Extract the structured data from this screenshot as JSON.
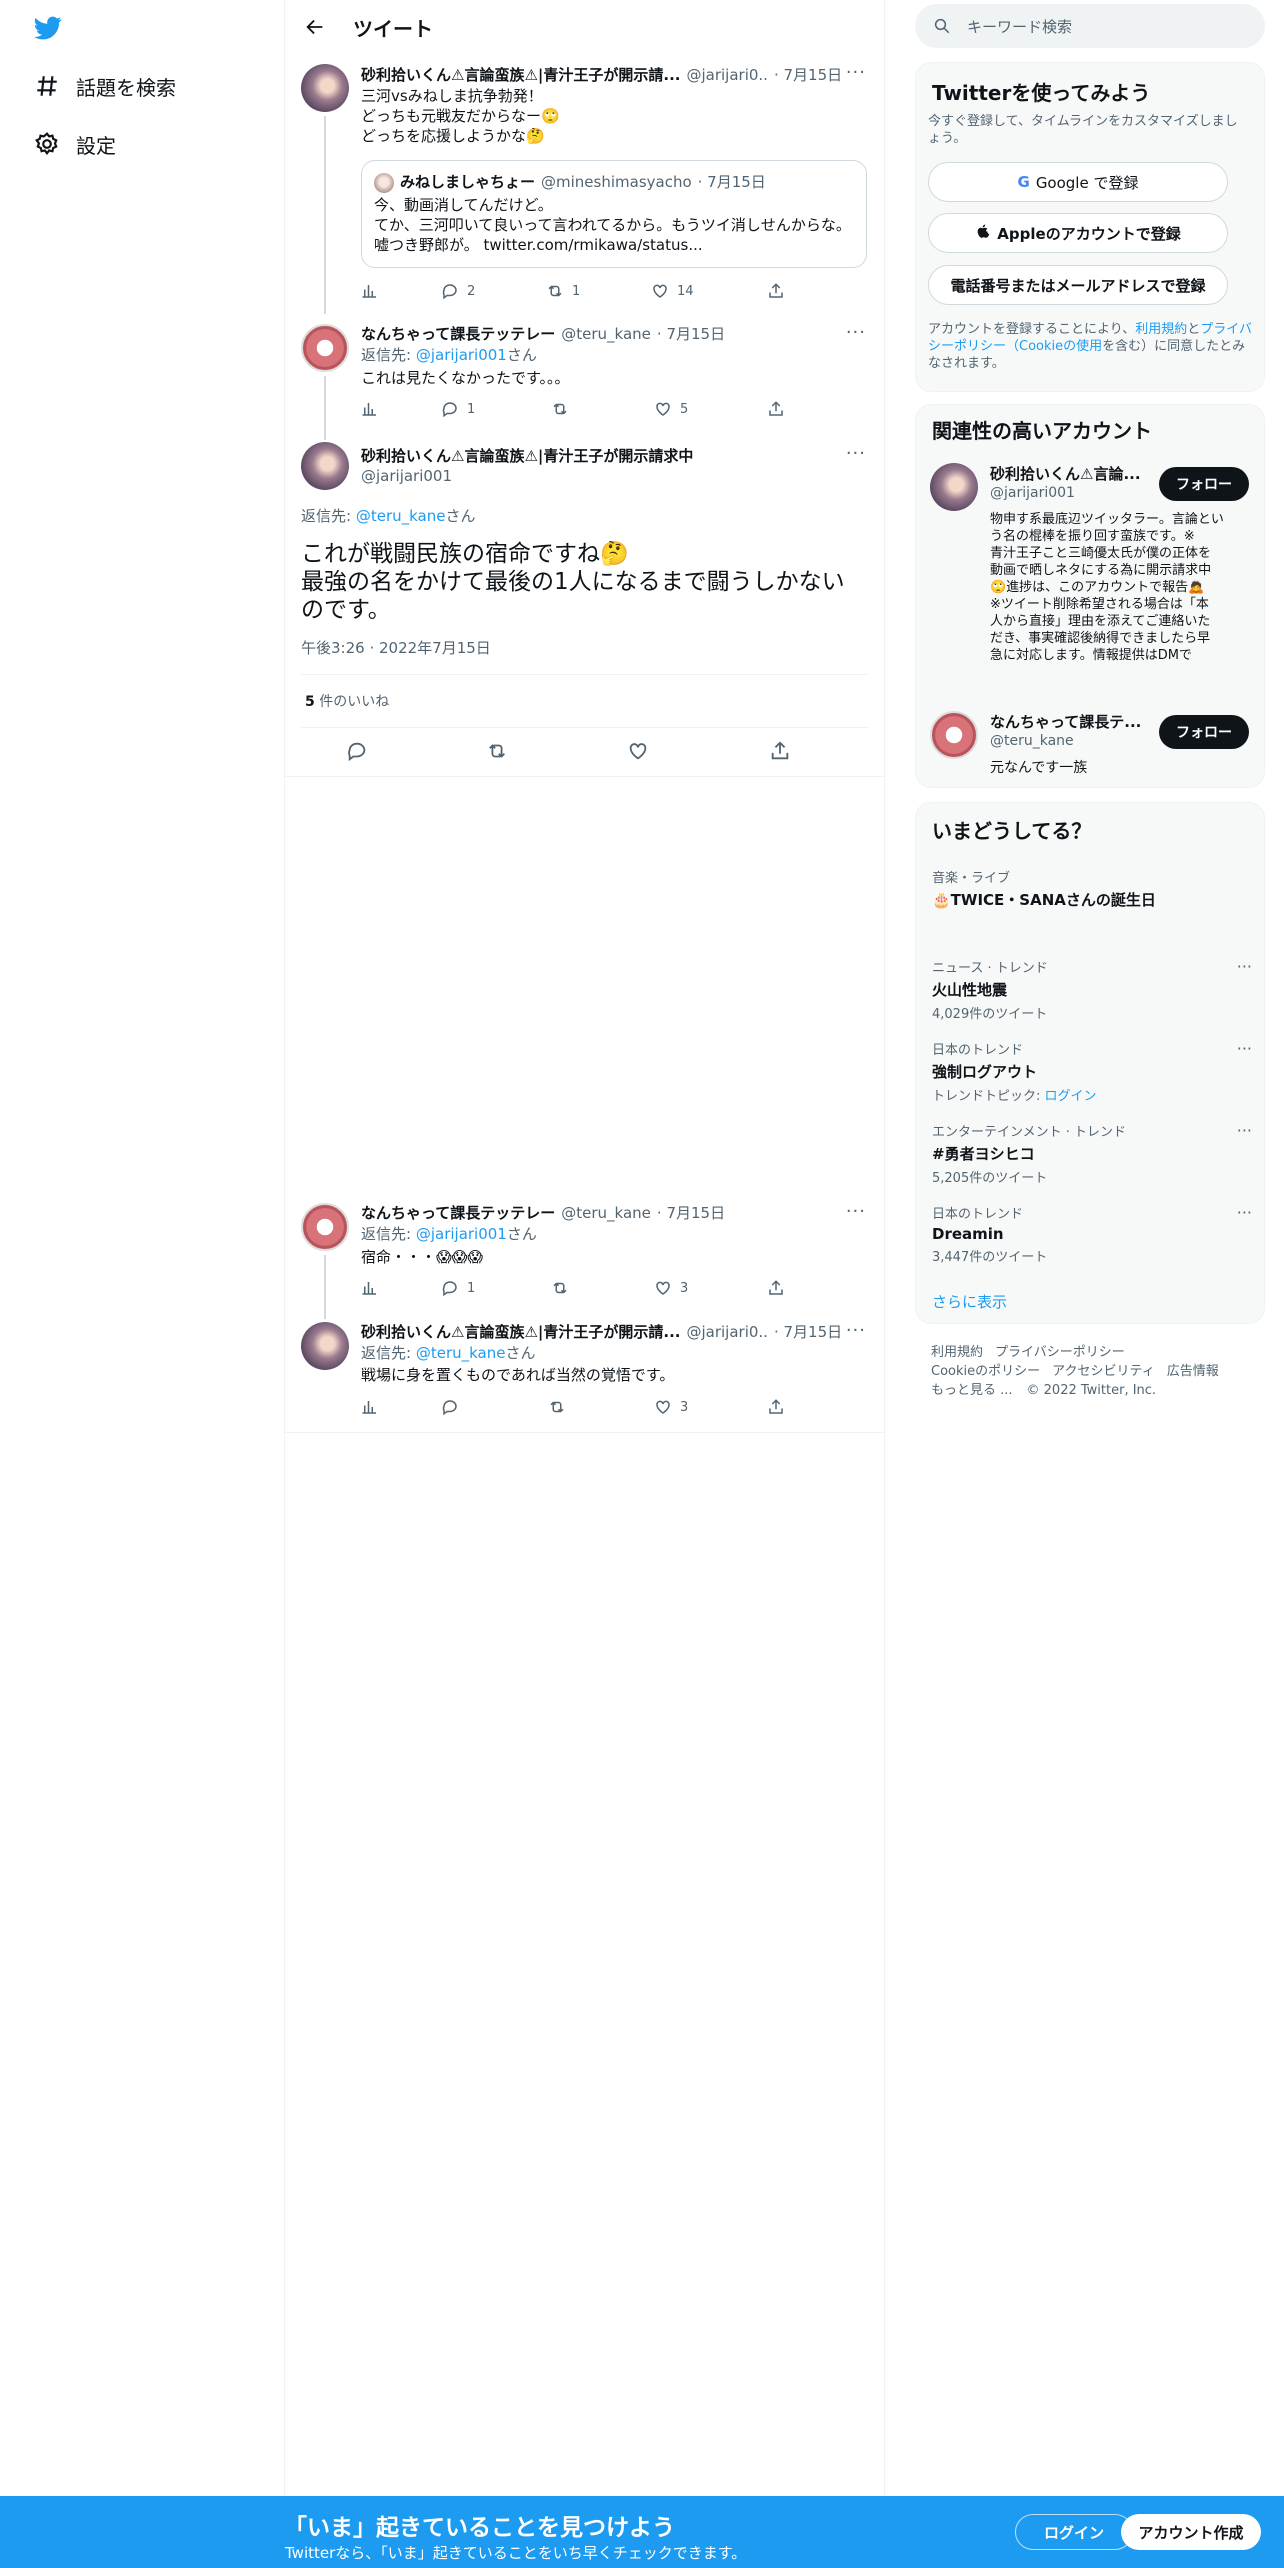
{
  "nav": {
    "explore_label": "話題を検索",
    "settings_label": "設定"
  },
  "header": {
    "title": "ツイート"
  },
  "tweet1": {
    "name": "砂利拾いくん⚠言論蛮族⚠|青汁王子が開示請...",
    "handle": "@jarijari0..",
    "date": "· 7月15日",
    "lines": [
      "三河vsみねしま抗争勃発！",
      "どっちも元戦友だからなー🙄",
      "どっちを応援しようかな🤔"
    ],
    "quote": {
      "name": "みねしましゃちょー",
      "handle": "@mineshimasyacho",
      "date": "· 7月15日",
      "lines": [
        "今、動画消してんだけど。",
        "てか、三河叩いて良いって言われてるから。もうツイ消しせんからな。",
        "嘘つき野郎が。 twitter.com/rmikawa/status..."
      ]
    },
    "replies": "2",
    "retweets": "1",
    "likes": "14"
  },
  "tweet2": {
    "name": "なんちゃって課長テッテレー",
    "handle": "@teru_kane",
    "date": "· 7月15日",
    "reply_prefix": "返信先: ",
    "reply_to": "@jarijari001",
    "reply_suffix": "さん",
    "text": "これは見たくなかったです。。。",
    "replies": "1",
    "retweets": "",
    "likes": "5"
  },
  "main_tweet": {
    "name": "砂利拾いくん⚠言論蛮族⚠|青汁王子が開示請求中",
    "handle": "@jarijari001",
    "reply_prefix": "返信先: ",
    "reply_to": "@teru_kane",
    "reply_suffix": "さん",
    "line1": "これが戦闘民族の宿命ですね🤔",
    "line2": "最強の名をかけて最後の1人になるまで闘うしかない",
    "line3": "のです。",
    "timestamp": "午後3:26 · 2022年7月15日",
    "likes_count": "5",
    "likes_label": " 件のいいね"
  },
  "tweet3": {
    "name": "なんちゃって課長テッテレー",
    "handle": "@teru_kane",
    "date": "· 7月15日",
    "reply_prefix": "返信先: ",
    "reply_to": "@jarijari001",
    "reply_suffix": "さん",
    "text": "宿命・・・😱😱😱",
    "replies": "1",
    "retweets": "",
    "likes": "3"
  },
  "tweet4": {
    "name": "砂利拾いくん⚠言論蛮族⚠|青汁王子が開示請...",
    "handle": "@jarijari0..",
    "date": "· 7月15日",
    "reply_prefix": "返信先: ",
    "reply_to": "@teru_kane",
    "reply_suffix": "さん",
    "text": "戦場に身を置くものであれば当然の覚悟です。",
    "replies": "",
    "retweets": "",
    "likes": "3"
  },
  "search": {
    "placeholder": "キーワード検索"
  },
  "signup_card": {
    "title": "Twitterを使ってみよう",
    "subtitle": "今すぐ登録して、タイムラインをカスタマイズしましょう。",
    "google": "Google で登録",
    "apple": "Appleのアカウントで登録",
    "phone": "電話番号またはメールアドレスで登録",
    "legal_1": "アカウントを登録することにより、",
    "legal_terms": "利用規約",
    "legal_2": "と",
    "legal_privacy": "プライバシーポリシー（Cookieの使用",
    "legal_3": "を含む）に同意したとみなされます。"
  },
  "related": {
    "title": "関連性の高いアカウント",
    "follow": "フォロー",
    "acc1": {
      "name": "砂利拾いくん⚠言論...",
      "handle": "@jarijari001",
      "bio": [
        "物申す系最底辺ツイッタラー。言論とい",
        "う名の棍棒を振り回す蛮族です。※",
        "青汁王子こと三崎優太氏が僕の正体を",
        "動画で晒しネタにする為に開示請求中",
        "🙄進捗は、このアカウントで報告🙇",
        "※ツイート削除希望される場合は「本",
        "人から直接」理由を添えてご連絡いた",
        "だき、事実確認後納得できましたら早",
        "急に対応します。情報提供はDMで"
      ]
    },
    "acc2": {
      "name": "なんちゃって課長テ...",
      "handle": "@teru_kane",
      "bio": "元なんです一族"
    }
  },
  "trends": {
    "title": "いまどうしてる？",
    "items": [
      {
        "cat": "音楽・ライブ",
        "title": "🎂TWICE・SANAさんの誕生日",
        "count": ""
      },
      {
        "cat": "ニュース · トレンド",
        "title": "火山性地震",
        "count": "4,029件のツイート"
      },
      {
        "cat": "日本のトレンド",
        "title": "強制ログアウト",
        "count_prefix": "トレンドトピック: ",
        "count_link": "ログイン"
      },
      {
        "cat": "エンターテインメント · トレンド",
        "title": "#勇者ヨシヒコ",
        "count": "5,205件のツイート"
      },
      {
        "cat": "日本のトレンド",
        "title": "Dreamin",
        "count": "3,447件のツイート"
      }
    ],
    "show_more": "さらに表示"
  },
  "footer": {
    "line1": [
      "利用規約",
      "プライバシーポリシー"
    ],
    "line2": [
      "Cookieのポリシー",
      "アクセシビリティ",
      "広告情報"
    ],
    "more": "もっと見る ...",
    "copyright": "© 2022 Twitter, Inc."
  },
  "bottom_bar": {
    "headline": "「いま」起きていることを見つけよう",
    "sub": "Twitterなら、「いま」起きていることをいち早くチェックできます。",
    "login": "ログイン",
    "signup": "アカウント作成"
  },
  "colors": {
    "accent": "#1d9bf0",
    "text": "#0f1419",
    "muted": "#536471"
  }
}
